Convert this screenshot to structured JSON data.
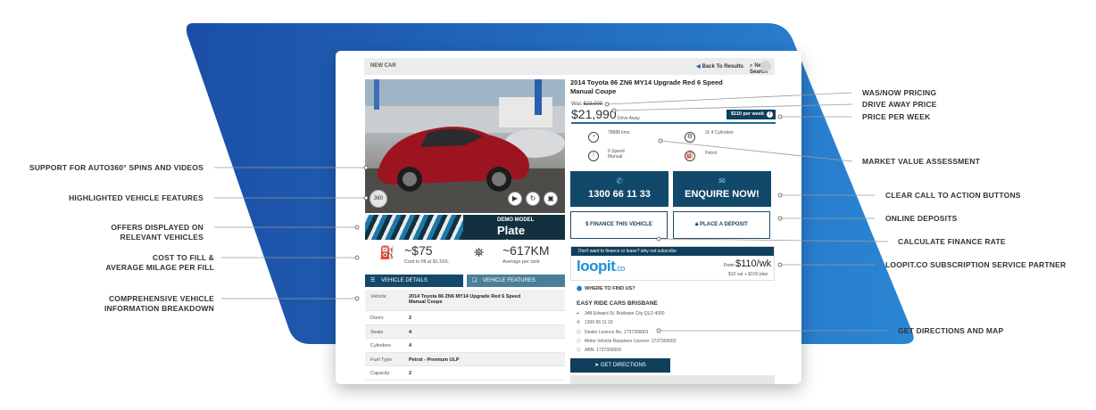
{
  "topbar": {
    "title": "NEW CAR",
    "back_label": "Back To Results",
    "new_search_label": "New Search"
  },
  "listing": {
    "title": "2014 Toyota 86 ZN6 MY14 Upgrade Red 6 Speed Manual Coupe",
    "was_prefix": "Was",
    "was_price": "$23,000",
    "price": "$21,990",
    "drive_away": "Drive Away",
    "per_week": "$110 per week",
    "features": [
      {
        "icon": "odometer-icon",
        "text": "78888 kms"
      },
      {
        "icon": "engine-icon",
        "text": "2L 4 Cylinders"
      },
      {
        "icon": "gearbox-icon",
        "text": "6 Speed Manual"
      },
      {
        "icon": "fuel-icon",
        "text": "Petrol"
      }
    ]
  },
  "banner": {
    "demo": "DEMO MODEL",
    "plate": "Plate Clearance"
  },
  "stats": {
    "fill_value": "~$75",
    "fill_sub": "Cost to fill at $1.50/L",
    "range_value": "~617KM",
    "range_sub": "Average per tank"
  },
  "tabs": {
    "details": "VEHICLE DETAILS",
    "features": "VEHICLE FEATURES"
  },
  "specs": [
    {
      "k": "Vehicle",
      "v": "2014 Toyota 86 ZN6 MY14 Upgrade Red 6 Speed Manual Coupe"
    },
    {
      "k": "Doors",
      "v": "2"
    },
    {
      "k": "Seats",
      "v": "4"
    },
    {
      "k": "Cylinders",
      "v": "4"
    },
    {
      "k": "Fuel Type",
      "v": "Petrol - Premium ULP"
    },
    {
      "k": "Capacity",
      "v": "2"
    }
  ],
  "cta": {
    "phone": "1300 66 11 33",
    "enquire": "ENQUIRE NOW!",
    "finance": "FINANCE THIS VEHICLE",
    "deposit": "PLACE A DEPOSIT"
  },
  "loopit": {
    "header": "Don't want to finance or lease? why not subscribe",
    "logo": "loopit",
    "logo_suffix": ".co",
    "from": "From",
    "amount": "$110/wk",
    "plan": "$10 car + $100 plan"
  },
  "dealer": {
    "where": "WHERE TO FIND US?",
    "name": "EASY RIDE CARS BRISBANE",
    "lines": [
      "348 Edward St, Brisbane City QLD 4000",
      "1300 66 11 33",
      "Dealer Licence No. 1737300001",
      "Motor Vehicle Repairers Licence: 1737300002",
      "ABN: 1737300009"
    ],
    "directions": "GET DIRECTIONS"
  },
  "callouts_left": [
    "SUPPORT FOR AUTO360° SPINS AND VIDEOS",
    "HIGHLIGHTED VEHICLE FEATURES",
    "OFFERS DISPLAYED ON",
    "RELEVANT VEHICLES",
    "COST TO FILL &",
    "AVERAGE MILAGE PER FILL",
    "COMPREHENSIVE VEHICLE",
    "INFORMATION BREAKDOWN"
  ],
  "callouts_right": [
    "WAS/NOW PRICING",
    "DRIVE AWAY PRICE",
    "PRICE PER WEEK",
    "MARKET VALUE ASSESSMENT",
    "CLEAR CALL TO ACTION BUTTONS",
    "ONLINE DEPOSITS",
    "CALCULATE FINANCE RATE",
    "LOOPIT.CO SUBSCRIPTION SERVICE PARTNER",
    "GET DIRECTIONS AND MAP"
  ],
  "colors": {
    "brand_blue": "#1a5fa8",
    "navy": "#0f3f5c",
    "accent_light_blue": "#1d8fd6"
  }
}
